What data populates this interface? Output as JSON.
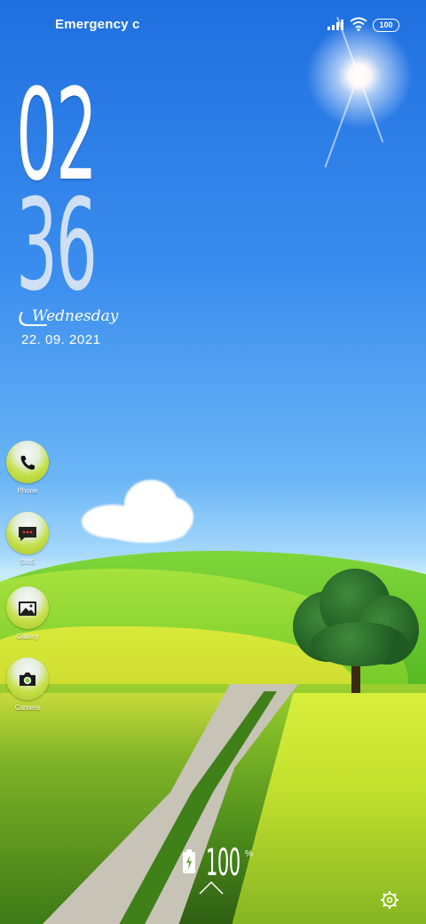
{
  "status_bar": {
    "carrier_text": "Emergency c",
    "battery_level": "100"
  },
  "clock": {
    "hour": "02",
    "minute": "36",
    "weekday": "Wednesday",
    "date": "22. 09. 2021"
  },
  "shortcuts": [
    {
      "label": "Phone",
      "icon": "phone-icon"
    },
    {
      "label": "SMS",
      "icon": "message-icon"
    },
    {
      "label": "Gallery",
      "icon": "gallery-icon"
    },
    {
      "label": "Camera",
      "icon": "camera-icon"
    }
  ],
  "charging": {
    "percent_value": "100",
    "percent_sign": "%"
  },
  "colors": {
    "sky_top": "#1f6fe0",
    "sky_bottom": "#a6d8fb",
    "bubble_green": "#c7e04a",
    "text": "#ffffff"
  }
}
